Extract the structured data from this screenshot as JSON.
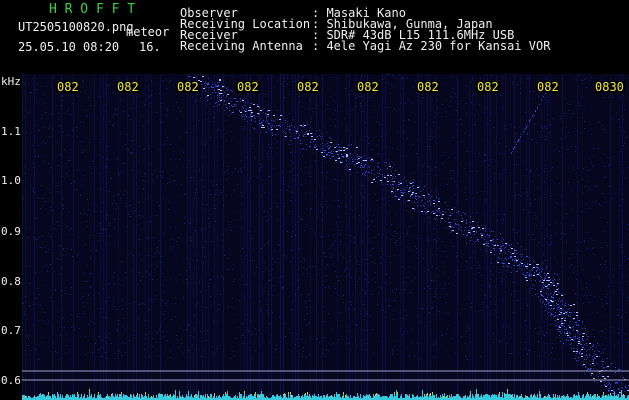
{
  "header": {
    "station_code": "H R O F F T",
    "filename": "UT2505100820.png",
    "tag": "meteor",
    "datetime": "25.05.10 08:20",
    "count": "16.",
    "fields": [
      {
        "label": "Observer",
        "value": ": Masaki Kano"
      },
      {
        "label": "Receiving Location",
        "value": ": Shibukawa, Gunma, Japan"
      },
      {
        "label": "Receiver",
        "value": ": SDR# 43dB L15 111.6MHz USB"
      },
      {
        "label": "Receiving Antenna",
        "value": ": 4ele Yagi Az 230 for Kansai VOR"
      }
    ]
  },
  "axis": {
    "unit": "kHz",
    "y_ticks": [
      "1.1",
      "1.0",
      "0.9",
      "0.8",
      "0.7",
      "0.6"
    ],
    "x_ticks": [
      "082",
      "082",
      "082",
      "082",
      "082",
      "082",
      "082",
      "082",
      "082",
      "0830"
    ]
  },
  "colors": {
    "background": "#000000",
    "title": "#3cd23c",
    "text": "#f0f0f0",
    "time": "#f4ea3a",
    "signal": "#3c5cff",
    "noise_floor": "#36d6e8"
  }
}
